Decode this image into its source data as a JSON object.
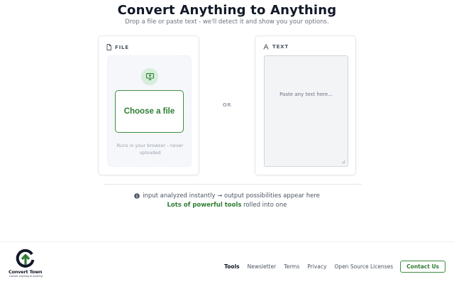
{
  "header": {
    "title": "Convert Anything to Anything",
    "subtitle": "Drop a file or paste text - we'll detect it and show you your options."
  },
  "file_card": {
    "label": "FILE",
    "icon": "document-icon",
    "upload_icon": "monitor-upload-icon",
    "choose_label": "Choose a file",
    "note": "Runs in your browser - never uploaded"
  },
  "separator": {
    "label": "OR"
  },
  "text_card": {
    "label": "TEXT",
    "icon": "text-icon",
    "value": "",
    "placeholder": "Paste any text here..."
  },
  "info": {
    "line": "input analyzed instantly → output possibilities appear here",
    "icon": "info-icon",
    "tagline_strong": "Lots of powerful tools",
    "tagline_rest": " rolled into one"
  },
  "footer": {
    "logo_name": "Convert Town",
    "logo_tagline": "Convert anything to anything",
    "nav": {
      "tools": "Tools",
      "newsletter": "Newsletter",
      "terms": "Terms",
      "privacy": "Privacy",
      "open_source": "Open Source Licenses"
    },
    "contact_label": "Contact Us"
  },
  "colors": {
    "accent": "#2e7d32",
    "accent_border": "#3e8e41",
    "badge_bg": "#d7eedb"
  }
}
